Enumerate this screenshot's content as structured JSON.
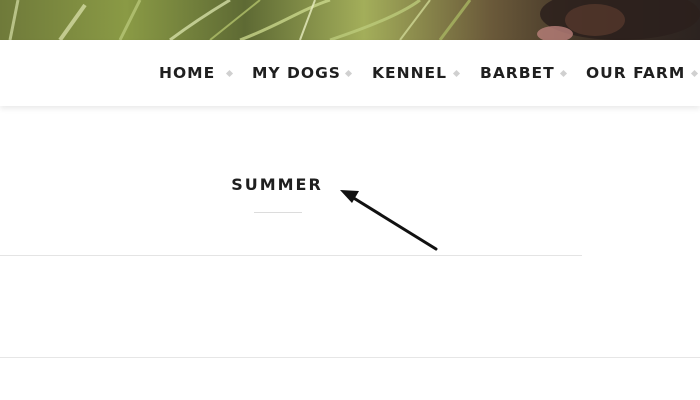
{
  "navigation": {
    "items": [
      {
        "label": "HOME"
      },
      {
        "label": "MY DOGS"
      },
      {
        "label": "KENNEL"
      },
      {
        "label": "BARBET"
      },
      {
        "label": "OUR FARM"
      }
    ]
  },
  "content": {
    "section_title": "SUMMER"
  },
  "colors": {
    "text": "#1f1f1f",
    "separator": "#d0d0d0",
    "background": "#ffffff"
  }
}
